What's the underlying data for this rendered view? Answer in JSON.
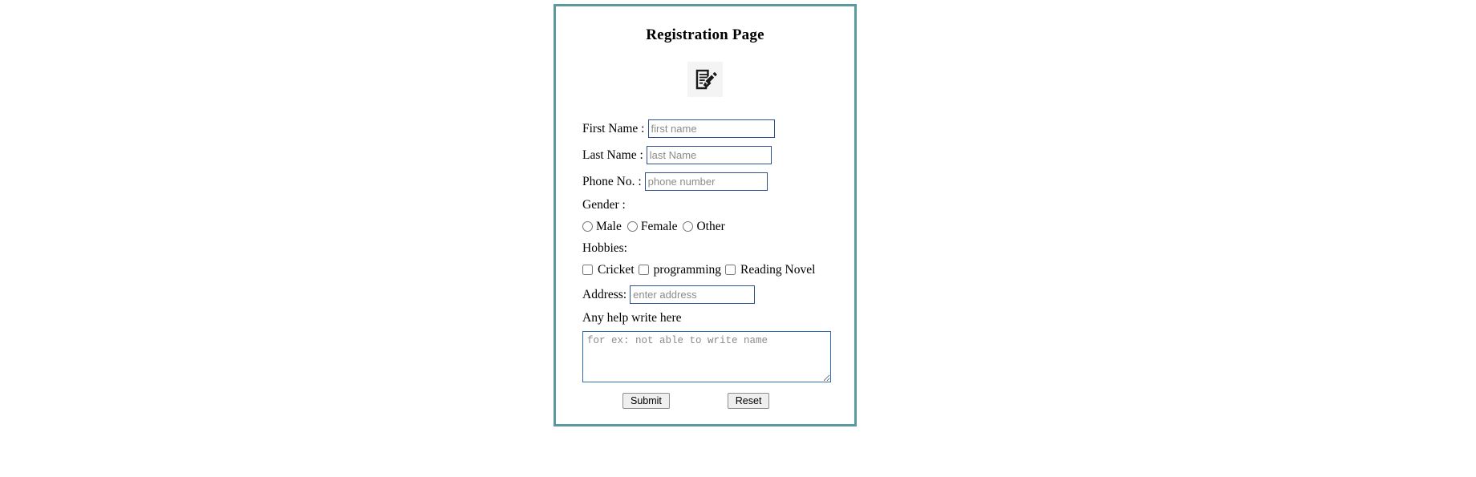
{
  "page": {
    "title": "Registration Page",
    "icon_name": "registration-form-edit-icon",
    "border_color": "#5a9a9e",
    "input_border_color": "#2f4f8f",
    "textarea_border_color": "#2f6fb0",
    "icon_background_color": "#f4f4f4"
  },
  "form": {
    "first_name": {
      "label": "First Name :",
      "placeholder": "first name",
      "value": ""
    },
    "last_name": {
      "label": "Last Name :",
      "placeholder": "last Name",
      "value": ""
    },
    "phone": {
      "label": "Phone No. :",
      "placeholder": "phone number",
      "value": ""
    },
    "gender": {
      "label": "Gender :",
      "options": [
        {
          "label": "Male",
          "checked": false
        },
        {
          "label": "Female",
          "checked": false
        },
        {
          "label": "Other",
          "checked": false
        }
      ]
    },
    "hobbies": {
      "label": "Hobbies:",
      "options": [
        {
          "label": "Cricket",
          "checked": false
        },
        {
          "label": "programming",
          "checked": false
        },
        {
          "label": "Reading Novel",
          "checked": false
        }
      ]
    },
    "address": {
      "label": "Address:",
      "placeholder": "enter address",
      "value": ""
    },
    "help": {
      "label": "Any help write here",
      "placeholder": "for ex: not able to write name",
      "value": ""
    },
    "buttons": {
      "submit_label": "Submit",
      "reset_label": "Reset"
    }
  }
}
